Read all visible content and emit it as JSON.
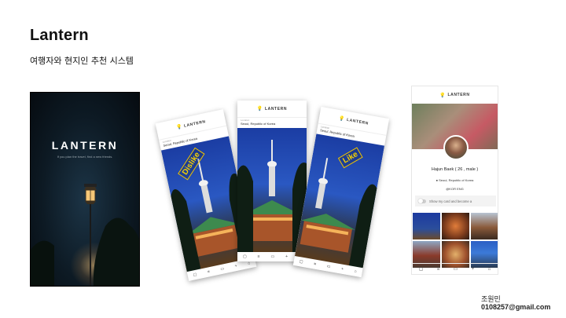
{
  "slide": {
    "title": "Lantern",
    "subtitle": "여행자와 현지인 추천 시스템",
    "author": "조원민",
    "email": "0108257@gmail.com"
  },
  "splash": {
    "brand": "LANTERN",
    "tagline": "If you plan the travel, find a new friends."
  },
  "cards": {
    "app_name": "LANTERN",
    "location_caption": "Location",
    "location": "Seoul, Republic of Korea",
    "dislike_label": "Dislike",
    "like_label": "Like",
    "stamp_color": "#f2c400"
  },
  "profile": {
    "app_name": "LANTERN",
    "name": "Hajun Baek ( 26 , male )",
    "location": "Seoul, Republic of Korea",
    "language": "KOR ENG",
    "toggle_text": "Show my card and become a",
    "nav_icons": [
      "card-icon",
      "list-icon",
      "chat-icon",
      "plus-icon",
      "home-icon"
    ]
  },
  "colors": {
    "accent_bulb": "#e3a31c",
    "splash_bg": "#0d1a24"
  }
}
